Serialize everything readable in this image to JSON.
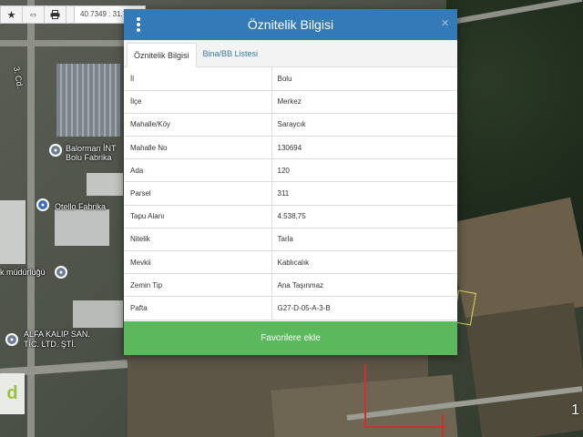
{
  "map": {
    "coordinates": "40.7349 : 31.7244",
    "labels": {
      "street": "3. Cd.",
      "poi1_line1": "Balorman İNT",
      "poi1_line2": "Bolu Fabrika",
      "poi2": "Otello Fabrika",
      "poi3": "k müdürlüğü",
      "poi4_line1": "ALFA KALIP SAN.",
      "poi4_line2": "TİC. LTD. ŞTİ."
    },
    "scale_text": "1",
    "brand_letter": "d"
  },
  "modal": {
    "title": "Öznitelik Bilgisi",
    "close_symbol": "×",
    "tabs": [
      {
        "label": "Öznitelik Bilgisi",
        "active": true
      },
      {
        "label": "Bina/BB Listesi",
        "active": false
      }
    ],
    "rows": [
      {
        "key": "İl",
        "value": "Bolu"
      },
      {
        "key": "İlçe",
        "value": "Merkez"
      },
      {
        "key": "Mahalle/Köy",
        "value": "Saraycık"
      },
      {
        "key": "Mahalle No",
        "value": "130694"
      },
      {
        "key": "Ada",
        "value": "120"
      },
      {
        "key": "Parsel",
        "value": "311"
      },
      {
        "key": "Tapu Alanı",
        "value": "4.538,75"
      },
      {
        "key": "Nitelik",
        "value": "Tarla"
      },
      {
        "key": "Mevkii",
        "value": "Kablıcalık"
      },
      {
        "key": "Zemin Tip",
        "value": "Ana Taşınmaz"
      },
      {
        "key": "Pafta",
        "value": "G27-D-05-A-3-B"
      }
    ],
    "favorite_button": "Favorilere ekle"
  },
  "colors": {
    "header_blue": "#337ab7",
    "button_green": "#5cb85c",
    "parcel_red": "#d03030"
  },
  "icons": {
    "toolbar": [
      "star-icon",
      "arrows-icon",
      "print-icon"
    ],
    "modal_menu": "kebab-menu-icon",
    "modal_close": "close-icon"
  }
}
